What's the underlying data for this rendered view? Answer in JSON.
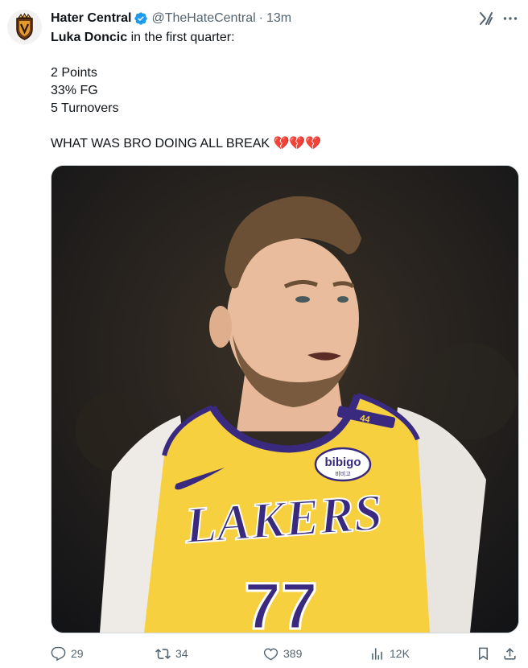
{
  "author": {
    "display_name": "Hater Central",
    "handle": "@TheHateCentral",
    "separator": "·",
    "time": "13m"
  },
  "tweet": {
    "line1_bold": "Luka Doncic",
    "line1_rest": " in the first quarter:",
    "stats": [
      "2 Points",
      "33% FG",
      "5 Turnovers"
    ],
    "closing": "WHAT WAS BRO DOING ALL BREAK 💔💔💔"
  },
  "media": {
    "jersey_brand": "LAKERS",
    "jersey_number": "77",
    "sponsor": "bibigo",
    "sponsor_sub": "비비고",
    "strap_number": "44"
  },
  "actions": {
    "replies": "29",
    "reposts": "34",
    "likes": "389",
    "views": "12K"
  },
  "icons": {
    "verified": "verified-badge-icon",
    "grok": "grok-icon",
    "more": "more-icon",
    "reply": "reply-icon",
    "repost": "repost-icon",
    "like": "like-icon",
    "views": "views-icon",
    "bookmark": "bookmark-icon",
    "share": "share-icon"
  },
  "colors": {
    "verified_blue": "#1d9bf0",
    "secondary_text": "#536471",
    "lakers_gold": "#f6d03f",
    "lakers_purple": "#3a2a7f"
  }
}
